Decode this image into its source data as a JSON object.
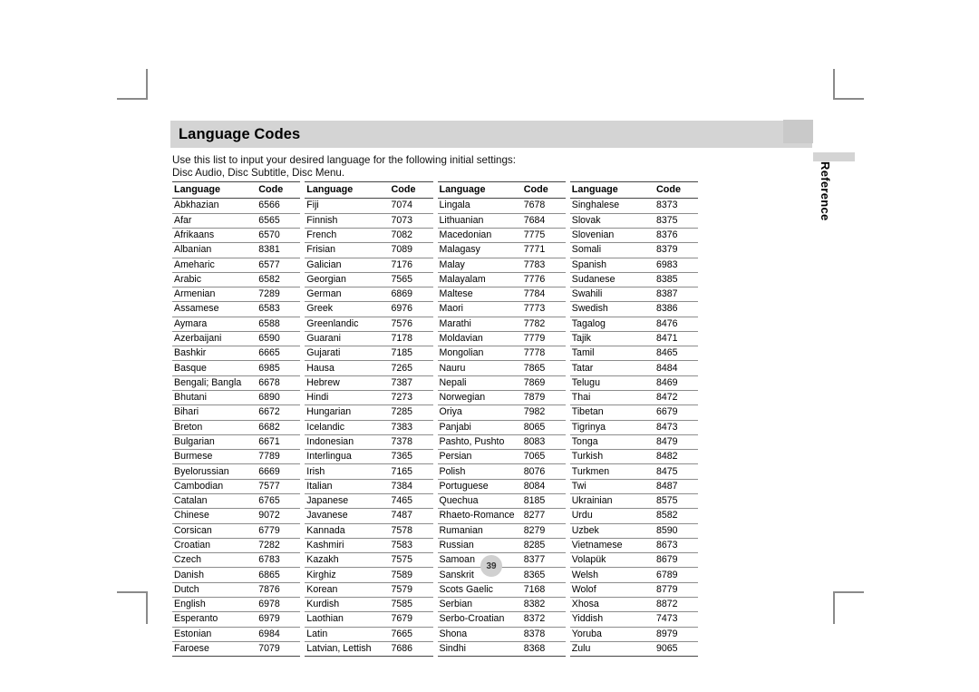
{
  "document": {
    "title": "Language Codes",
    "intro_line_1": "Use this list to input your desired language for the following initial settings:",
    "intro_line_2": "Disc Audio, Disc Subtitle, Disc Menu.",
    "page_number": "39",
    "side_tab_label": "Reference",
    "colors": {
      "title_band": "#d4d4d4",
      "side_tab_band": "#d4d4d4",
      "page_badge": "#d0d0d0",
      "rule_dark": "#444444",
      "rule_light": "#8c8c8c",
      "crop_mark": "#8a8a8a"
    }
  },
  "table": {
    "headers": {
      "language": "Language",
      "code": "Code"
    },
    "columns": [
      {
        "rows": [
          {
            "language": "Abkhazian",
            "code": "6566"
          },
          {
            "language": "Afar",
            "code": "6565"
          },
          {
            "language": "Afrikaans",
            "code": "6570"
          },
          {
            "language": "Albanian",
            "code": "8381"
          },
          {
            "language": "Ameharic",
            "code": "6577"
          },
          {
            "language": "Arabic",
            "code": "6582"
          },
          {
            "language": "Armenian",
            "code": "7289"
          },
          {
            "language": "Assamese",
            "code": "6583"
          },
          {
            "language": "Aymara",
            "code": "6588"
          },
          {
            "language": "Azerbaijani",
            "code": "6590"
          },
          {
            "language": "Bashkir",
            "code": "6665"
          },
          {
            "language": "Basque",
            "code": "6985"
          },
          {
            "language": "Bengali; Bangla",
            "code": "6678"
          },
          {
            "language": "Bhutani",
            "code": "6890"
          },
          {
            "language": "Bihari",
            "code": "6672"
          },
          {
            "language": "Breton",
            "code": "6682"
          },
          {
            "language": "Bulgarian",
            "code": "6671"
          },
          {
            "language": "Burmese",
            "code": "7789"
          },
          {
            "language": "Byelorussian",
            "code": "6669"
          },
          {
            "language": "Cambodian",
            "code": "7577"
          },
          {
            "language": "Catalan",
            "code": "6765"
          },
          {
            "language": "Chinese",
            "code": "9072"
          },
          {
            "language": "Corsican",
            "code": "6779"
          },
          {
            "language": "Croatian",
            "code": "7282"
          },
          {
            "language": "Czech",
            "code": "6783"
          },
          {
            "language": "Danish",
            "code": "6865"
          },
          {
            "language": "Dutch",
            "code": "7876"
          },
          {
            "language": "English",
            "code": "6978"
          },
          {
            "language": "Esperanto",
            "code": "6979"
          },
          {
            "language": "Estonian",
            "code": "6984"
          },
          {
            "language": "Faroese",
            "code": "7079"
          }
        ]
      },
      {
        "rows": [
          {
            "language": "Fiji",
            "code": "7074"
          },
          {
            "language": "Finnish",
            "code": "7073"
          },
          {
            "language": "French",
            "code": "7082"
          },
          {
            "language": "Frisian",
            "code": "7089"
          },
          {
            "language": "Galician",
            "code": "7176"
          },
          {
            "language": "Georgian",
            "code": "7565"
          },
          {
            "language": "German",
            "code": "6869"
          },
          {
            "language": "Greek",
            "code": "6976"
          },
          {
            "language": "Greenlandic",
            "code": "7576"
          },
          {
            "language": "Guarani",
            "code": "7178"
          },
          {
            "language": "Gujarati",
            "code": "7185"
          },
          {
            "language": "Hausa",
            "code": "7265"
          },
          {
            "language": "Hebrew",
            "code": "7387"
          },
          {
            "language": "Hindi",
            "code": "7273"
          },
          {
            "language": "Hungarian",
            "code": "7285"
          },
          {
            "language": "Icelandic",
            "code": "7383"
          },
          {
            "language": "Indonesian",
            "code": "7378"
          },
          {
            "language": "Interlingua",
            "code": "7365"
          },
          {
            "language": "Irish",
            "code": "7165"
          },
          {
            "language": "Italian",
            "code": "7384"
          },
          {
            "language": "Japanese",
            "code": "7465"
          },
          {
            "language": "Javanese",
            "code": "7487"
          },
          {
            "language": "Kannada",
            "code": "7578"
          },
          {
            "language": "Kashmiri",
            "code": "7583"
          },
          {
            "language": "Kazakh",
            "code": "7575"
          },
          {
            "language": "Kirghiz",
            "code": "7589"
          },
          {
            "language": "Korean",
            "code": "7579"
          },
          {
            "language": "Kurdish",
            "code": "7585"
          },
          {
            "language": "Laothian",
            "code": "7679"
          },
          {
            "language": "Latin",
            "code": "7665"
          },
          {
            "language": "Latvian, Lettish",
            "code": "7686"
          }
        ]
      },
      {
        "rows": [
          {
            "language": "Lingala",
            "code": "7678"
          },
          {
            "language": "Lithuanian",
            "code": "7684"
          },
          {
            "language": "Macedonian",
            "code": "7775"
          },
          {
            "language": "Malagasy",
            "code": "7771"
          },
          {
            "language": "Malay",
            "code": "7783"
          },
          {
            "language": "Malayalam",
            "code": "7776"
          },
          {
            "language": "Maltese",
            "code": "7784"
          },
          {
            "language": "Maori",
            "code": "7773"
          },
          {
            "language": "Marathi",
            "code": "7782"
          },
          {
            "language": "Moldavian",
            "code": "7779"
          },
          {
            "language": "Mongolian",
            "code": "7778"
          },
          {
            "language": "Nauru",
            "code": "7865"
          },
          {
            "language": "Nepali",
            "code": "7869"
          },
          {
            "language": "Norwegian",
            "code": "7879"
          },
          {
            "language": "Oriya",
            "code": "7982"
          },
          {
            "language": "Panjabi",
            "code": "8065"
          },
          {
            "language": "Pashto, Pushto",
            "code": "8083"
          },
          {
            "language": "Persian",
            "code": "7065"
          },
          {
            "language": "Polish",
            "code": "8076"
          },
          {
            "language": "Portuguese",
            "code": "8084"
          },
          {
            "language": "Quechua",
            "code": "8185"
          },
          {
            "language": "Rhaeto-Romance",
            "code": "8277"
          },
          {
            "language": "Rumanian",
            "code": "8279"
          },
          {
            "language": "Russian",
            "code": "8285"
          },
          {
            "language": "Samoan",
            "code": "8377"
          },
          {
            "language": "Sanskrit",
            "code": "8365"
          },
          {
            "language": "Scots Gaelic",
            "code": "7168"
          },
          {
            "language": "Serbian",
            "code": "8382"
          },
          {
            "language": "Serbo-Croatian",
            "code": "8372"
          },
          {
            "language": "Shona",
            "code": "8378"
          },
          {
            "language": "Sindhi",
            "code": "8368"
          }
        ]
      },
      {
        "rows": [
          {
            "language": "Singhalese",
            "code": "8373"
          },
          {
            "language": "Slovak",
            "code": "8375"
          },
          {
            "language": "Slovenian",
            "code": "8376"
          },
          {
            "language": "Somali",
            "code": "8379"
          },
          {
            "language": "Spanish",
            "code": "6983"
          },
          {
            "language": "Sudanese",
            "code": "8385"
          },
          {
            "language": "Swahili",
            "code": "8387"
          },
          {
            "language": "Swedish",
            "code": "8386"
          },
          {
            "language": "Tagalog",
            "code": "8476"
          },
          {
            "language": "Tajik",
            "code": "8471"
          },
          {
            "language": "Tamil",
            "code": "8465"
          },
          {
            "language": "Tatar",
            "code": "8484"
          },
          {
            "language": "Telugu",
            "code": "8469"
          },
          {
            "language": "Thai",
            "code": "8472"
          },
          {
            "language": "Tibetan",
            "code": "6679"
          },
          {
            "language": "Tigrinya",
            "code": "8473"
          },
          {
            "language": "Tonga",
            "code": "8479"
          },
          {
            "language": "Turkish",
            "code": "8482"
          },
          {
            "language": "Turkmen",
            "code": "8475"
          },
          {
            "language": "Twi",
            "code": "8487"
          },
          {
            "language": "Ukrainian",
            "code": "8575"
          },
          {
            "language": "Urdu",
            "code": "8582"
          },
          {
            "language": "Uzbek",
            "code": "8590"
          },
          {
            "language": "Vietnamese",
            "code": "8673"
          },
          {
            "language": "Volapük",
            "code": "8679"
          },
          {
            "language": "Welsh",
            "code": "6789"
          },
          {
            "language": "Wolof",
            "code": "8779"
          },
          {
            "language": "Xhosa",
            "code": "8872"
          },
          {
            "language": "Yiddish",
            "code": "7473"
          },
          {
            "language": "Yoruba",
            "code": "8979"
          },
          {
            "language": "Zulu",
            "code": "9065"
          }
        ]
      }
    ]
  }
}
